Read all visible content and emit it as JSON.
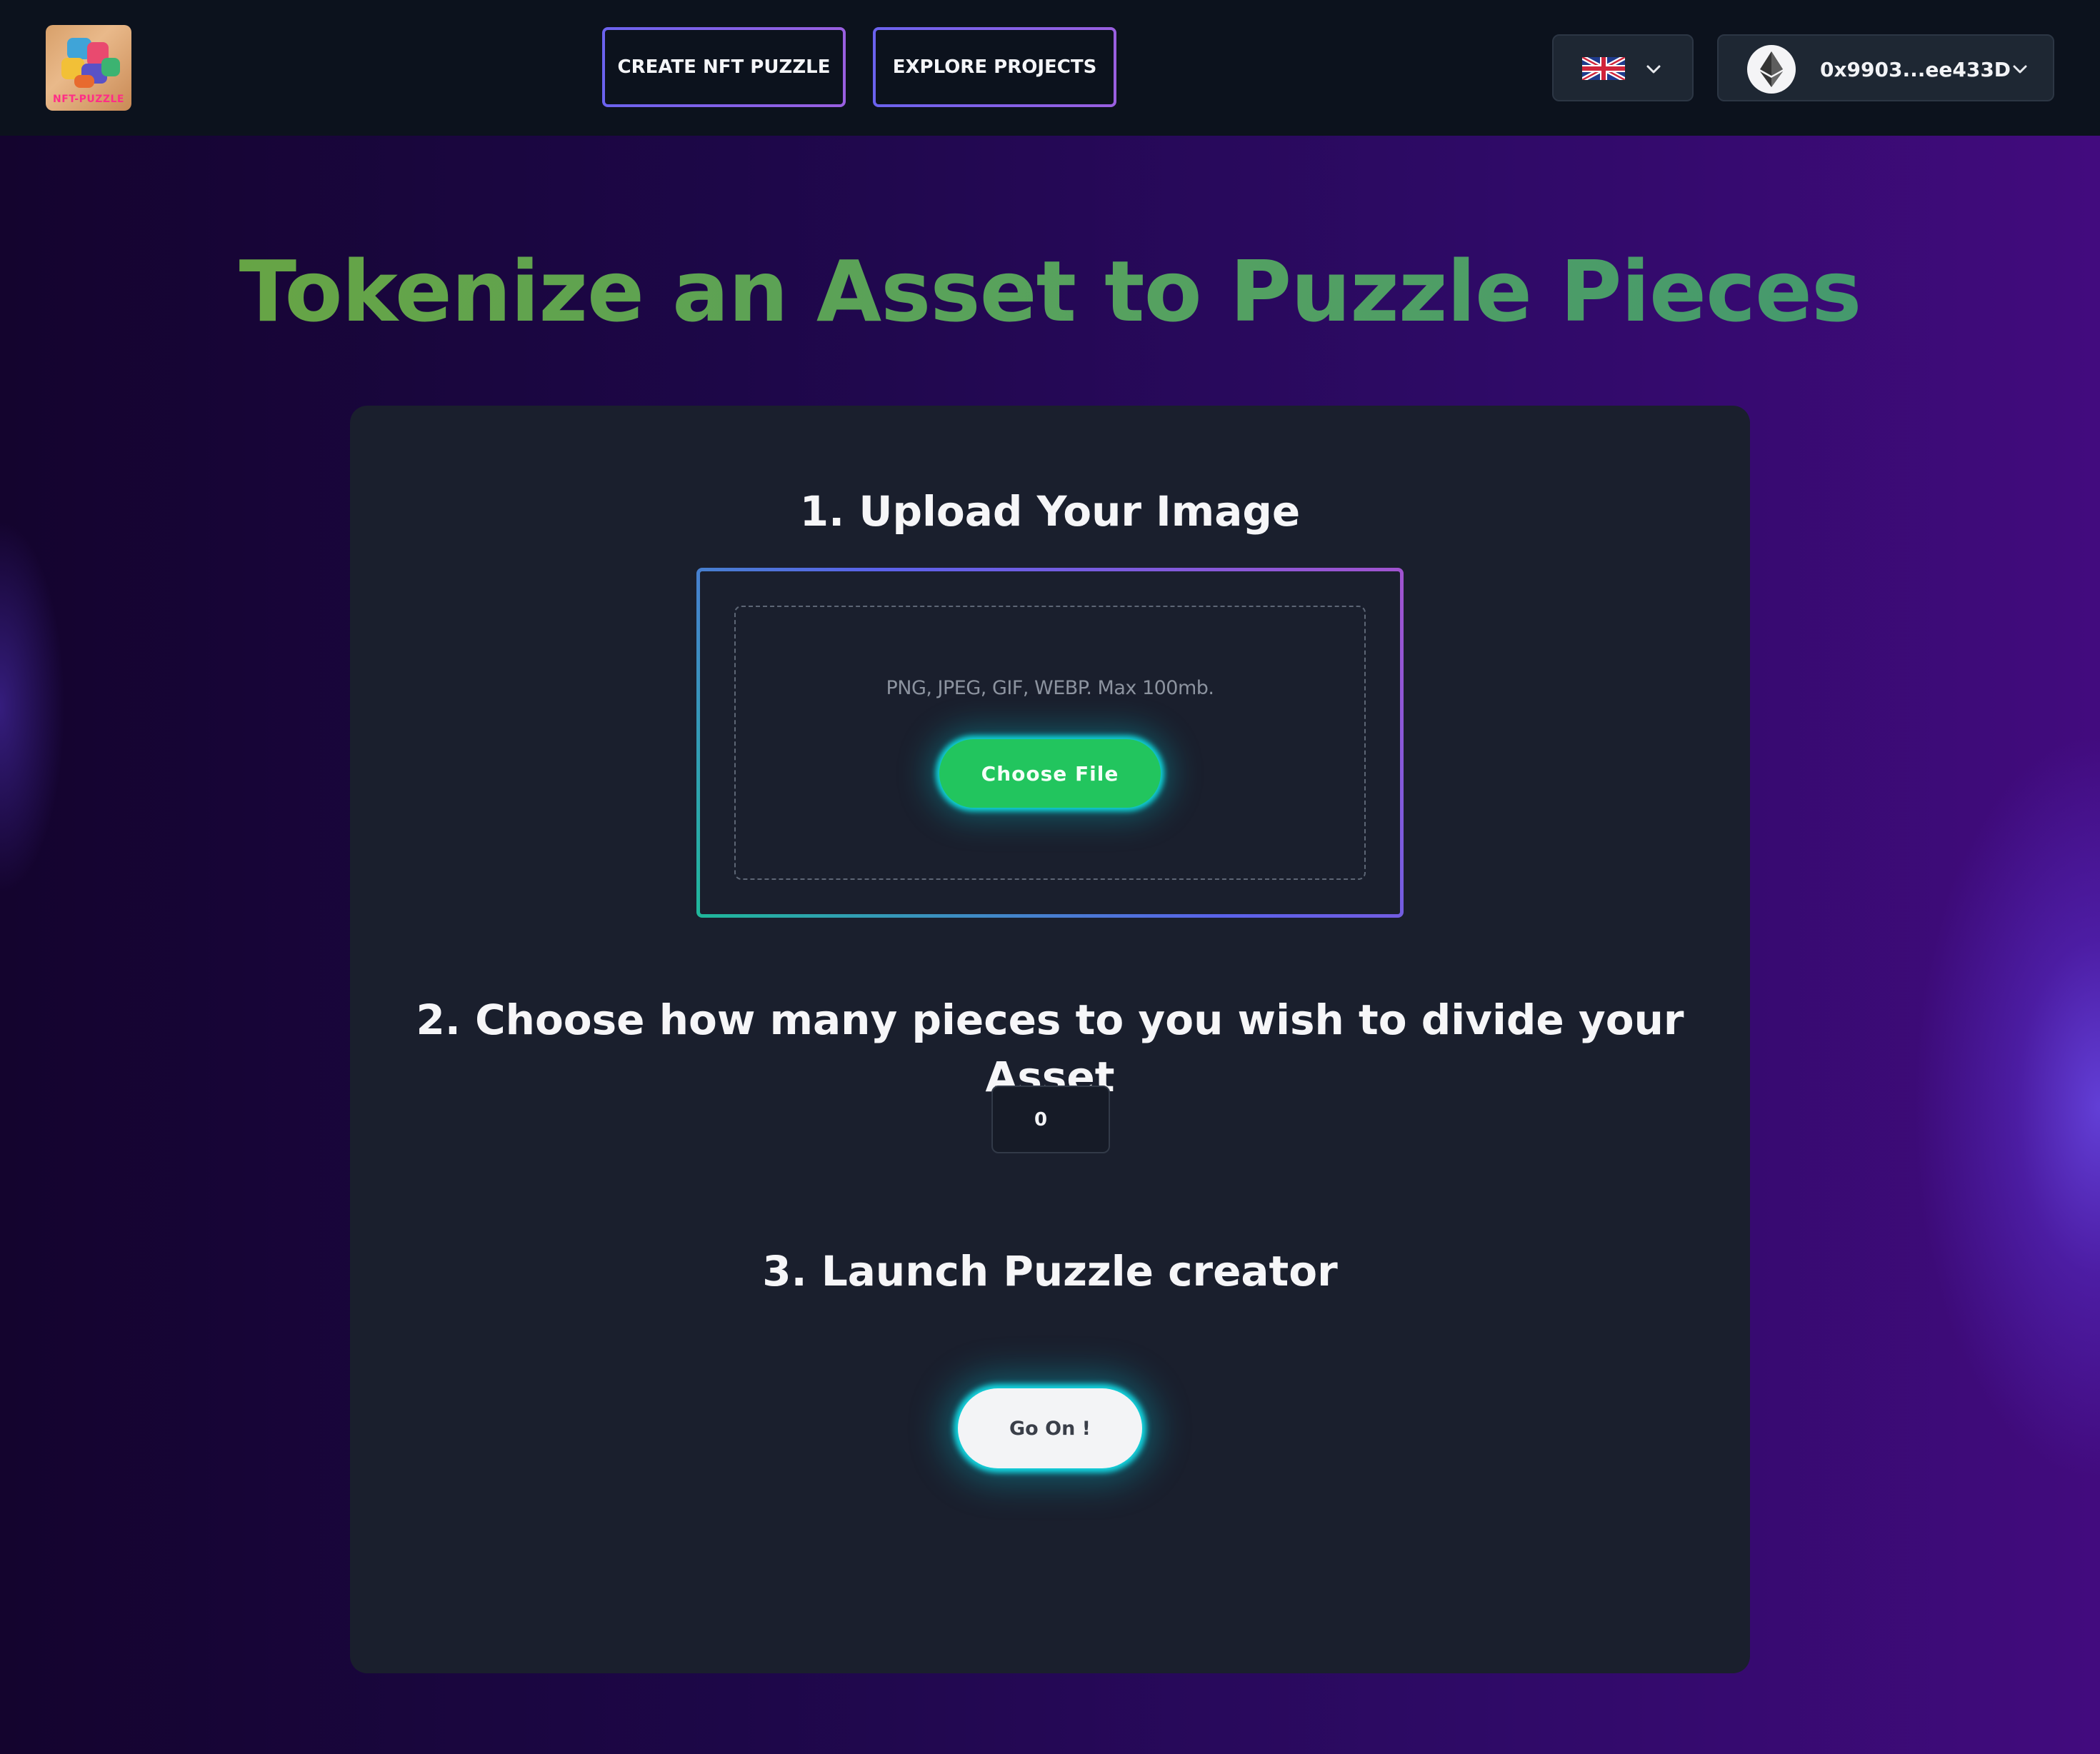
{
  "header": {
    "logo_text": "NFT-PUZZLE",
    "nav": {
      "create_label": "CREATE NFT PUZZLE",
      "explore_label": "EXPLORE PROJECTS"
    },
    "language": {
      "selected_flag": "uk-flag-icon"
    },
    "wallet": {
      "network_icon": "ethereum-icon",
      "address": "0x9903...ee433D"
    }
  },
  "main": {
    "title": "Tokenize an Asset to Puzzle Pieces",
    "steps": {
      "upload": {
        "title": "1. Upload Your Image",
        "hint": "PNG, JPEG, GIF, WEBP. Max 100mb.",
        "button_label": "Choose File"
      },
      "pieces": {
        "title": "2. Choose how many pieces to you wish to divide your Asset",
        "value": "0"
      },
      "launch": {
        "title": "3. Launch Puzzle creator",
        "button_label": "Go On !"
      }
    }
  },
  "colors": {
    "title_green": "#55a160",
    "accent_green": "#22c55e",
    "glow_cyan": "#14d6e0",
    "card_bg": "#1a1f2d",
    "topbar_bg": "#0c121d"
  }
}
